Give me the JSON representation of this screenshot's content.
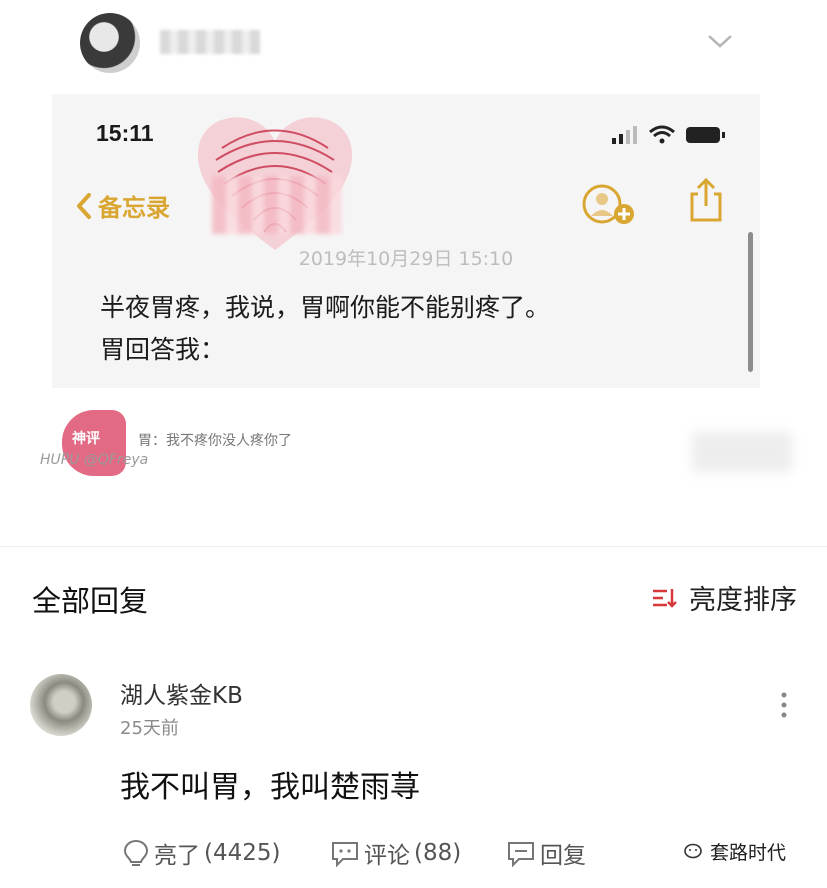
{
  "screenshot": {
    "status_time": "15:11",
    "back_label": "备忘录",
    "note_date": "2019年10月29日 15:10",
    "note_line1": "半夜胃疼，我说，胃啊你能不能别疼了。",
    "note_line2": "胃回答我："
  },
  "shenping": {
    "badge": "神评",
    "text": "胃：我不疼你没人疼你了",
    "source": "HUPU @QFreya"
  },
  "replies_header": {
    "title": "全部回复",
    "sort_label": "亮度排序"
  },
  "reply": {
    "username": "湖人紫金KB",
    "time": "25天前",
    "content": "我不叫胃，我叫楚雨荨",
    "like_label": "亮了",
    "like_count": "(4425)",
    "comment_label": "评论",
    "comment_count": "(88)",
    "reply_label": "回复"
  },
  "watermark": {
    "text": "套路时代"
  },
  "colors": {
    "accent": "#d9a632",
    "shenping": "#e36a84",
    "sort_icon": "#d9383a"
  }
}
